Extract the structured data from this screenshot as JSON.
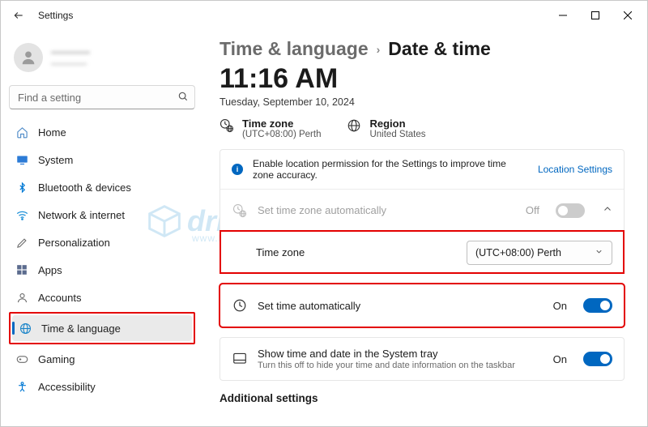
{
  "window": {
    "title": "Settings"
  },
  "profile": {
    "name": "————",
    "email": "————"
  },
  "search": {
    "placeholder": "Find a setting"
  },
  "sidebar": {
    "items": [
      {
        "label": "Home"
      },
      {
        "label": "System"
      },
      {
        "label": "Bluetooth & devices"
      },
      {
        "label": "Network & internet"
      },
      {
        "label": "Personalization"
      },
      {
        "label": "Apps"
      },
      {
        "label": "Accounts"
      },
      {
        "label": "Time & language"
      },
      {
        "label": "Gaming"
      },
      {
        "label": "Accessibility"
      }
    ]
  },
  "breadcrumb": {
    "parent": "Time & language",
    "current": "Date & time"
  },
  "clock": "11:16 AM",
  "date_line": "Tuesday, September 10, 2024",
  "summary": {
    "tz_label": "Time zone",
    "tz_value": "(UTC+08:00) Perth",
    "region_label": "Region",
    "region_value": "United States"
  },
  "banner": {
    "text": "Enable location permission for the Settings to improve time zone accuracy.",
    "link": "Location Settings"
  },
  "rows": {
    "set_tz_auto": {
      "label": "Set time zone automatically",
      "state": "Off"
    },
    "tz_select": {
      "label": "Time zone",
      "value": "(UTC+08:00) Perth"
    },
    "set_time_auto": {
      "label": "Set time automatically",
      "state": "On"
    },
    "tray": {
      "label": "Show time and date in the System tray",
      "sub": "Turn this off to hide your time and date information on the taskbar",
      "state": "On"
    }
  },
  "section": {
    "additional": "Additional settings"
  }
}
